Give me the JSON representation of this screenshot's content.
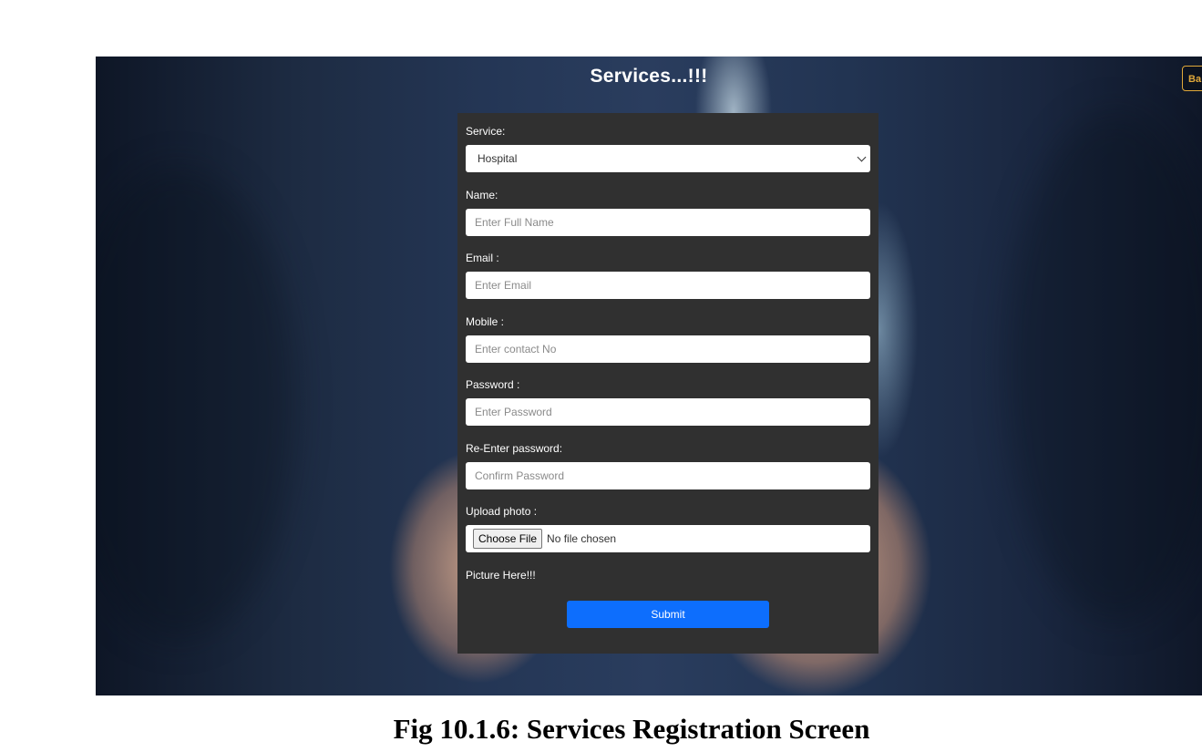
{
  "page": {
    "title": "Services...!!!",
    "back_button": "Ba"
  },
  "form": {
    "service": {
      "label": "Service:",
      "selected": "Hospital"
    },
    "name": {
      "label": "Name:",
      "placeholder": "Enter Full Name"
    },
    "email": {
      "label": "Email :",
      "placeholder": "Enter Email"
    },
    "mobile": {
      "label": "Mobile :",
      "placeholder": "Enter contact No"
    },
    "password": {
      "label": "Password :",
      "placeholder": "Enter Password"
    },
    "confirm_password": {
      "label": "Re-Enter password:",
      "placeholder": "Confirm Password"
    },
    "upload": {
      "label": "Upload photo :",
      "button": "Choose File",
      "status": "No file chosen"
    },
    "picture_text": "Picture Here!!!",
    "submit_label": "Submit"
  },
  "colors": {
    "card_background": "#303030",
    "submit_button": "#0d6efd",
    "back_button_border": "#e0a83a"
  },
  "caption": "Fig 10.1.6: Services Registration Screen"
}
